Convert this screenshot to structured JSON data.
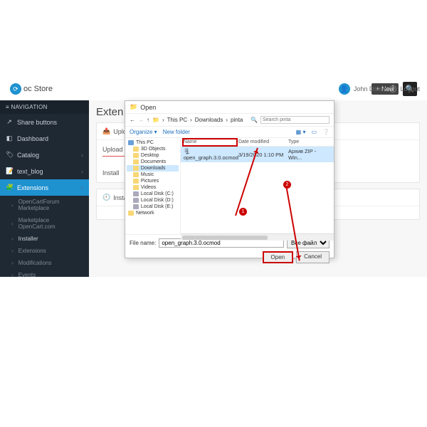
{
  "brand": {
    "name": "oc Store"
  },
  "topbar": {
    "new_btn": "+ New",
    "user": "John Doe",
    "logout": "Logout"
  },
  "sidebar": {
    "header": "≡ NAVIGATION",
    "items": [
      {
        "icon": "↗",
        "label": "Share buttons"
      },
      {
        "icon": "◧",
        "label": "Dashboard"
      },
      {
        "icon": "🏷",
        "label": "Catalog",
        "caret": true
      },
      {
        "icon": "📝",
        "label": "text_blog",
        "caret": true
      },
      {
        "icon": "🧩",
        "label": "Extensions",
        "active": true,
        "caret": true
      }
    ],
    "subs": [
      {
        "label": "OpenCartForum Marketplace"
      },
      {
        "label": "Marketplace OpenCart.com"
      },
      {
        "label": "Installer",
        "active": true
      },
      {
        "label": "Extensions"
      },
      {
        "label": "Modifications"
      },
      {
        "label": "Events"
      }
    ]
  },
  "page": {
    "title": "Exten",
    "upload_card": "Uplo",
    "upload_label": "Upload",
    "install_label": "Install",
    "history_title": "Install History"
  },
  "dialog": {
    "title": "Open",
    "crumbs": [
      "This PC",
      "Downloads",
      "pinta"
    ],
    "search_ph": "Search pinta",
    "organize": "Organize ▾",
    "newfolder": "New folder",
    "tree": [
      "This PC",
      "3D Objects",
      "Desktop",
      "Documents",
      "Downloads",
      "Music",
      "Pictures",
      "Videos",
      "Local Disk (C:)",
      "Local Disk (D:)",
      "Local Disk (E:)",
      "Network"
    ],
    "tree_sel": 4,
    "cols": {
      "name": "Name",
      "date": "Date modified",
      "type": "Type"
    },
    "file": {
      "name": "open_graph.3.0.ocmod",
      "date": "3/19/2020 1:10 PM",
      "type": "Архив ZIP - Win..."
    },
    "fn_label": "File name:",
    "fn_value": "open_graph.3.0.ocmod",
    "filter": "Все файлы",
    "open": "Open",
    "cancel": "Cancel"
  },
  "annot": {
    "n1": "1",
    "n2": "2"
  }
}
